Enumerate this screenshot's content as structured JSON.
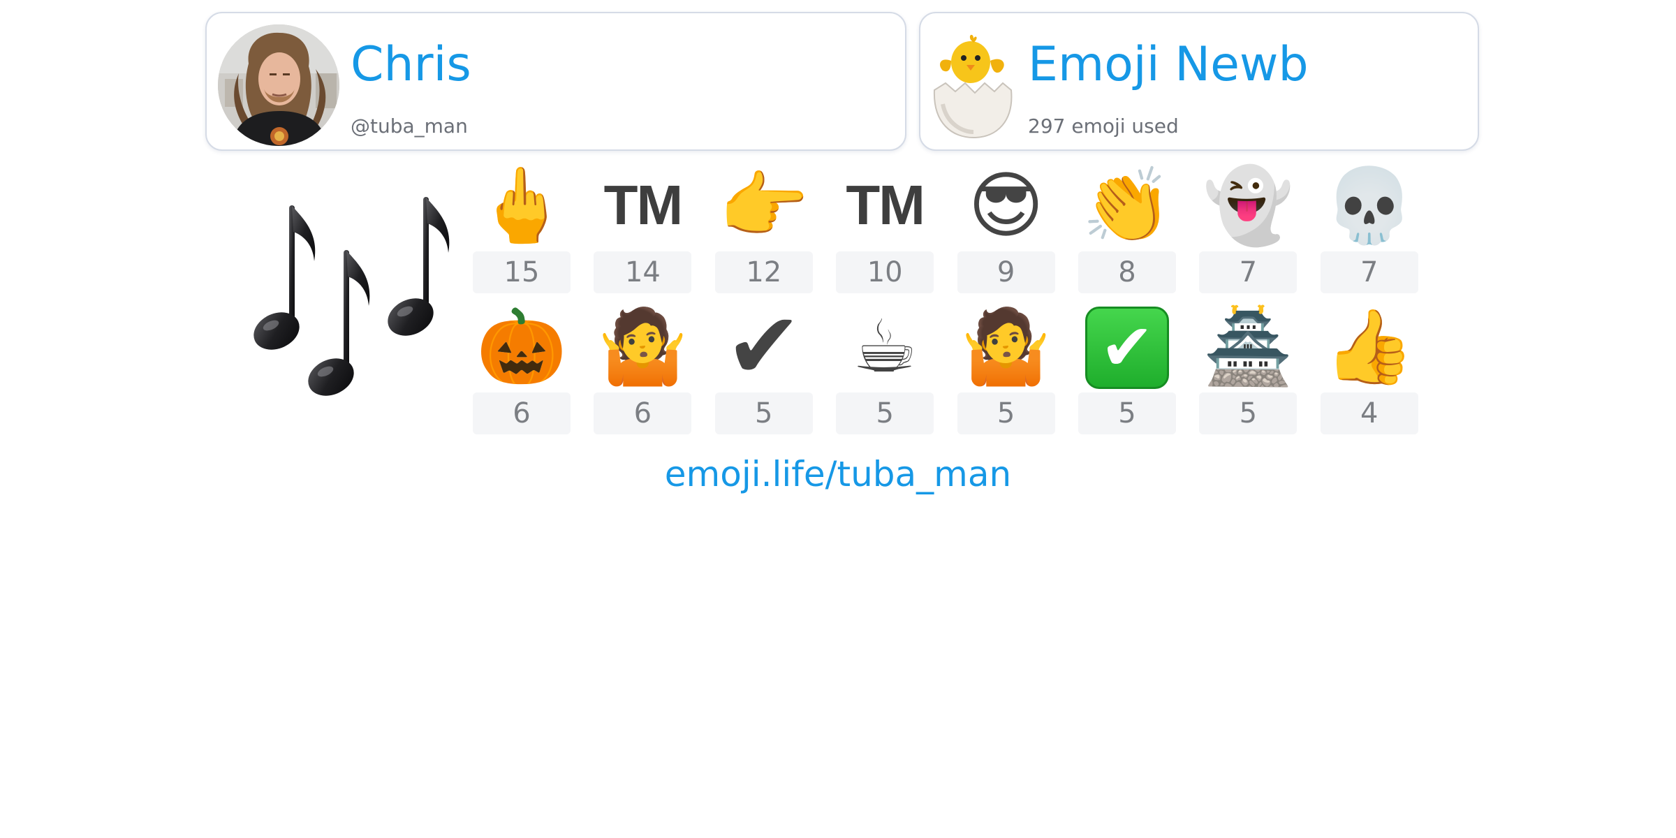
{
  "profile": {
    "name": "Chris",
    "handle": "@tuba_man",
    "avatar_icon": "user-photo"
  },
  "rank": {
    "title": "Emoji Newb",
    "subtitle": "297 emoji used",
    "icon": "hatching-chick"
  },
  "hero_emoji": {
    "icon": "musical-notes"
  },
  "emoji_counts": [
    {
      "icon": "middle-finger",
      "glyph": "🖕",
      "count": "15"
    },
    {
      "icon": "trademark",
      "glyph": "TM",
      "count": "14"
    },
    {
      "icon": "pointing-right",
      "glyph": "👉",
      "count": "12"
    },
    {
      "icon": "trademark",
      "glyph": "TM",
      "count": "10"
    },
    {
      "icon": "smiling-face-with-sunglasses",
      "glyph": "😎",
      "count": "9"
    },
    {
      "icon": "clapping-hands",
      "glyph": "👏",
      "count": "8"
    },
    {
      "icon": "ghost",
      "glyph": "👻",
      "count": "7"
    },
    {
      "icon": "skull",
      "glyph": "💀",
      "count": "7"
    },
    {
      "icon": "jack-o-lantern",
      "glyph": "🎃",
      "count": "6"
    },
    {
      "icon": "man-shrugging",
      "glyph": "🤷",
      "count": "6"
    },
    {
      "icon": "check-mark",
      "glyph": "✔",
      "count": "5"
    },
    {
      "icon": "hot-beverage",
      "glyph": "☕",
      "count": "5"
    },
    {
      "icon": "woman-shrugging",
      "glyph": "🤷",
      "count": "5"
    },
    {
      "icon": "check-mark-button",
      "glyph": "✔",
      "count": "5"
    },
    {
      "icon": "japanese-castle",
      "glyph": "🏯",
      "count": "5"
    },
    {
      "icon": "thumbs-up",
      "glyph": "👍",
      "count": "4"
    }
  ],
  "footer": {
    "link": "emoji.life/tuba_man"
  },
  "colors": {
    "accent": "#1698e6",
    "subtext": "#6b6f77",
    "count_text": "#7b7e83",
    "count_bg": "#f4f5f7"
  }
}
